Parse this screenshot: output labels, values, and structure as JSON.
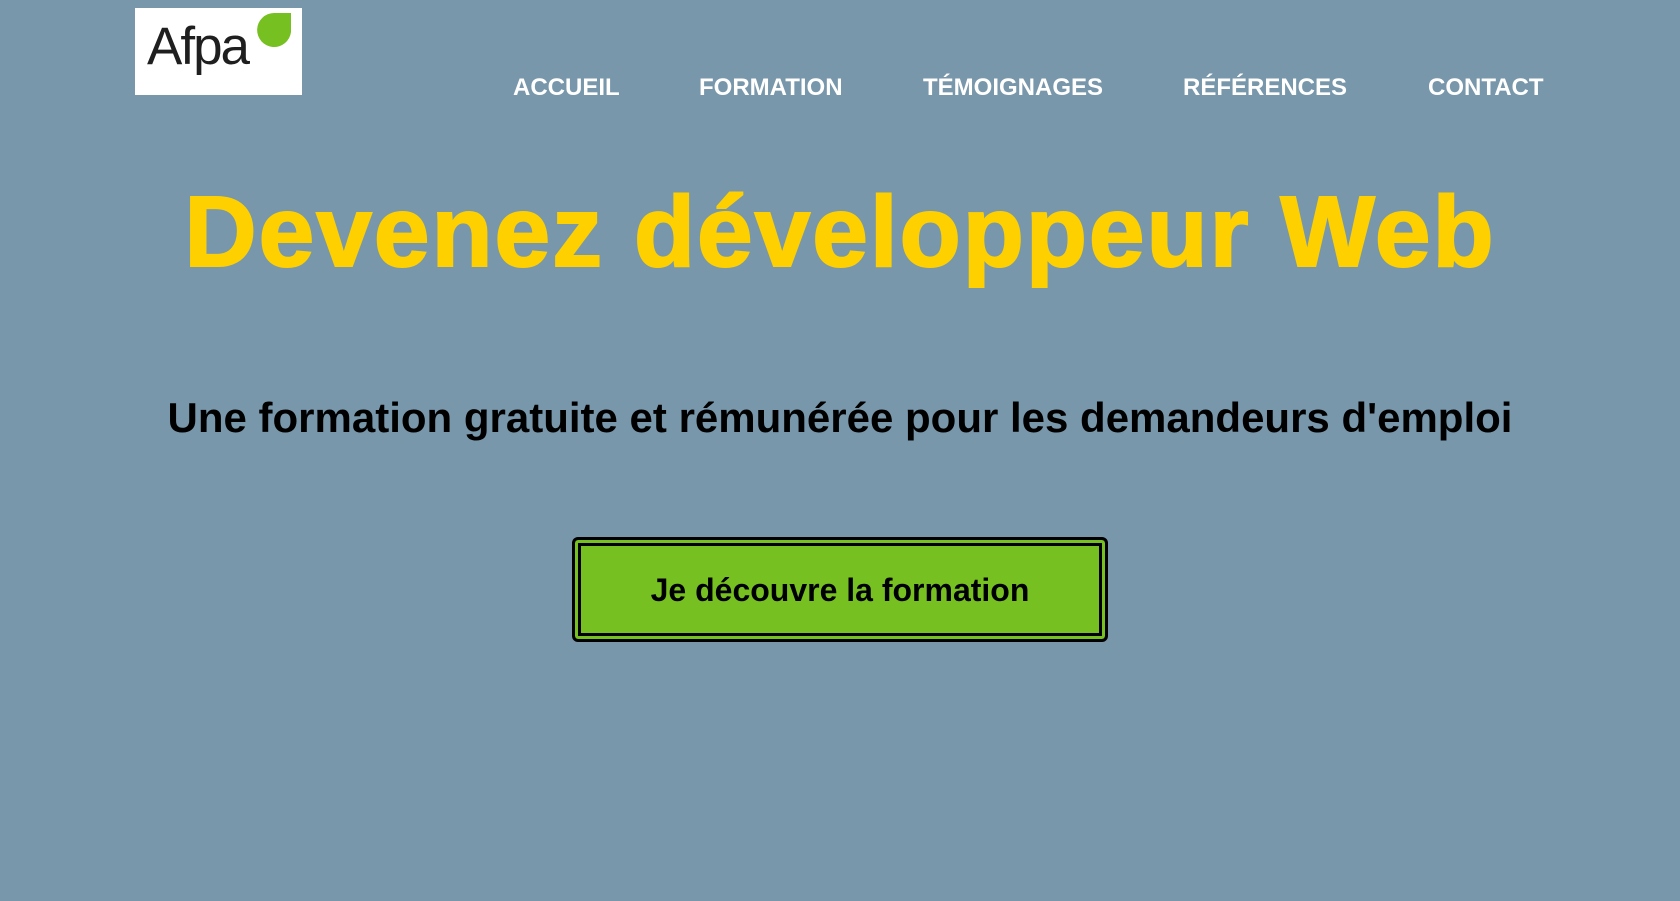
{
  "header": {
    "logo": {
      "text": "Afpa",
      "icon": "leaf-icon",
      "leaf_color": "#77c021"
    },
    "nav": {
      "items": [
        {
          "label": "ACCUEIL"
        },
        {
          "label": "FORMATION"
        },
        {
          "label": "TÉMOIGNAGES"
        },
        {
          "label": "RÉFÉRENCES"
        },
        {
          "label": "CONTACT"
        }
      ]
    }
  },
  "hero": {
    "title": "Devenez développeur Web",
    "subtitle": "Une formation gratuite et rémunérée pour les demandeurs d'emploi",
    "cta_label": "Je découvre la formation"
  },
  "colors": {
    "background": "#7897ab",
    "title": "#fed000",
    "cta_background": "#77c021",
    "nav_text": "#ffffff"
  }
}
